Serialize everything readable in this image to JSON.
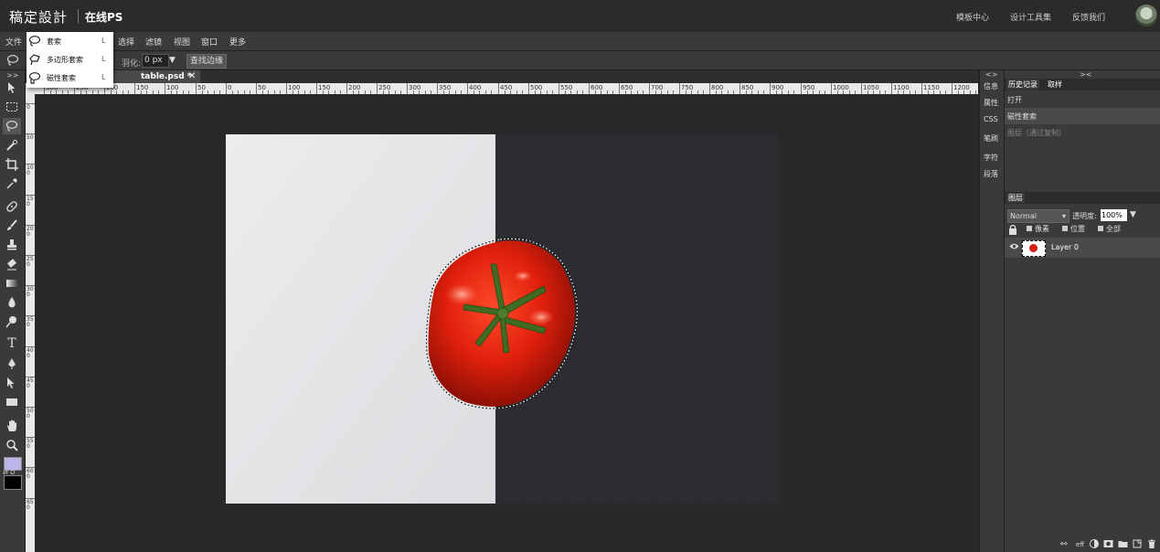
{
  "header": {
    "brand": "稿定設計",
    "subbrand": "在线PS",
    "links": [
      "模板中心",
      "设计工具集",
      "反馈我们"
    ]
  },
  "menubar": {
    "items": [
      "文件",
      "选择",
      "滤镜",
      "视图",
      "窗口",
      "更多"
    ]
  },
  "options": {
    "feather_label": "羽化:",
    "feather_value": "0 px",
    "refine_edge_label": "查找边缘"
  },
  "lasso_menu": {
    "items": [
      {
        "label": "套索",
        "key": "L"
      },
      {
        "label": "多边形套索",
        "key": "L"
      },
      {
        "label": "磁性套索",
        "key": "L"
      }
    ]
  },
  "toolbar": {
    "collapse": ">>",
    "swap_label": "⇄ D"
  },
  "document": {
    "tab_label": "table.psd *",
    "close": "✕"
  },
  "rulers": {
    "top_labels": [
      "300",
      "250",
      "200",
      "150",
      "100",
      "50",
      "0",
      "50",
      "100",
      "150",
      "200",
      "250",
      "300",
      "350",
      "400",
      "450",
      "500",
      "550",
      "600",
      "650",
      "700",
      "750",
      "800",
      "850",
      "900",
      "950",
      "1000",
      "1050",
      "1100",
      "1150",
      "1200"
    ],
    "left_labels": [
      "0",
      "50",
      "100",
      "150",
      "200",
      "250",
      "300",
      "350",
      "400",
      "450",
      "500",
      "550",
      "600",
      "650"
    ]
  },
  "side_icons": {
    "collapse": "<>",
    "items": [
      "信息",
      "属性",
      "CSS",
      "笔刷",
      "字符",
      "段落"
    ]
  },
  "history_panel": {
    "collapse": "><",
    "tabs": [
      "历史记录",
      "取样"
    ],
    "rows": [
      "打开",
      "磁性套索",
      "图层（通过复制）"
    ]
  },
  "layers_panel": {
    "tab": "图层",
    "blend_mode": "Normal",
    "opacity_label": "透明度:",
    "opacity_value": "100%",
    "lock_options": [
      "像素",
      "位置",
      "全部"
    ],
    "layer_name": "Layer 0"
  },
  "colors": {
    "foreground": "#b9b6e9",
    "background": "#000000",
    "accent": "#ffffff"
  }
}
